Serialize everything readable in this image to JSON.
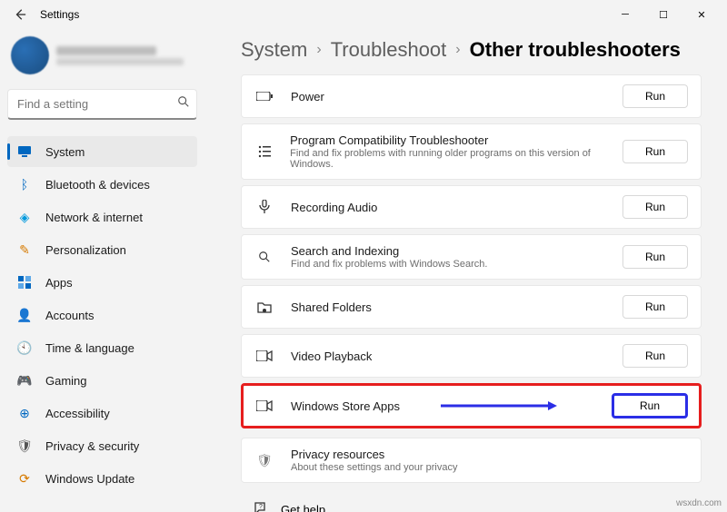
{
  "window": {
    "title": "Settings"
  },
  "search": {
    "placeholder": "Find a setting"
  },
  "sidebar": {
    "items": [
      {
        "label": "System"
      },
      {
        "label": "Bluetooth & devices"
      },
      {
        "label": "Network & internet"
      },
      {
        "label": "Personalization"
      },
      {
        "label": "Apps"
      },
      {
        "label": "Accounts"
      },
      {
        "label": "Time & language"
      },
      {
        "label": "Gaming"
      },
      {
        "label": "Accessibility"
      },
      {
        "label": "Privacy & security"
      },
      {
        "label": "Windows Update"
      }
    ]
  },
  "breadcrumb": {
    "a": "System",
    "b": "Troubleshoot",
    "c": "Other troubleshooters"
  },
  "troubleshooters": [
    {
      "title": "Power",
      "desc": "",
      "run": "Run"
    },
    {
      "title": "Program Compatibility Troubleshooter",
      "desc": "Find and fix problems with running older programs on this version of Windows.",
      "run": "Run"
    },
    {
      "title": "Recording Audio",
      "desc": "",
      "run": "Run"
    },
    {
      "title": "Search and Indexing",
      "desc": "Find and fix problems with Windows Search.",
      "run": "Run"
    },
    {
      "title": "Shared Folders",
      "desc": "",
      "run": "Run"
    },
    {
      "title": "Video Playback",
      "desc": "",
      "run": "Run"
    },
    {
      "title": "Windows Store Apps",
      "desc": "",
      "run": "Run"
    }
  ],
  "privacy": {
    "title": "Privacy resources",
    "desc": "About these settings and your privacy"
  },
  "help": {
    "label": "Get help"
  },
  "watermark": "wsxdn.com"
}
